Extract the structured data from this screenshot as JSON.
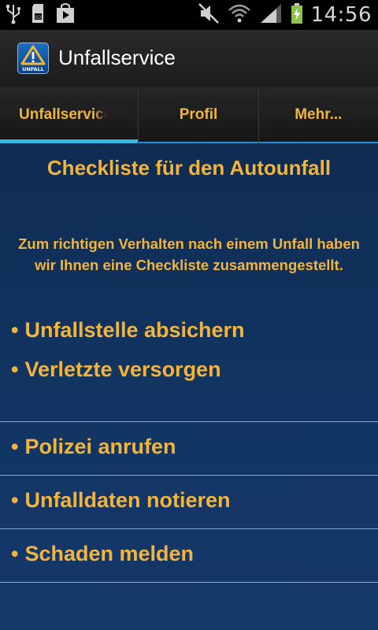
{
  "status_bar": {
    "time": "14:56",
    "icons": [
      "usb-icon",
      "sd-card-icon",
      "play-store-icon",
      "mute-icon",
      "wifi-icon",
      "signal-icon",
      "battery-charging-icon"
    ]
  },
  "action_bar": {
    "app_icon": "warning-triangle-icon",
    "app_icon_label": "UNFALL",
    "title": "Unfallservice"
  },
  "tabs": [
    {
      "label": "Unfallservice",
      "selected": true
    },
    {
      "label": "Profil",
      "selected": false
    },
    {
      "label": "Mehr...",
      "selected": false
    }
  ],
  "content": {
    "heading": "Checkliste für den Autounfall",
    "intro_line1": "Zum richtigen Verhalten nach einem Unfall haben",
    "intro_line2": "wir Ihnen eine Checkliste zusammengestellt.",
    "bullet": "•",
    "items": [
      "Unfallstelle absichern",
      "Verletzte versorgen",
      "Polizei anrufen",
      "Unfalldaten notieren",
      "Schaden melden"
    ]
  },
  "colors": {
    "accent": "#f3b43b",
    "tab_indicator": "#33b5e5",
    "background": "#0f2c52"
  }
}
